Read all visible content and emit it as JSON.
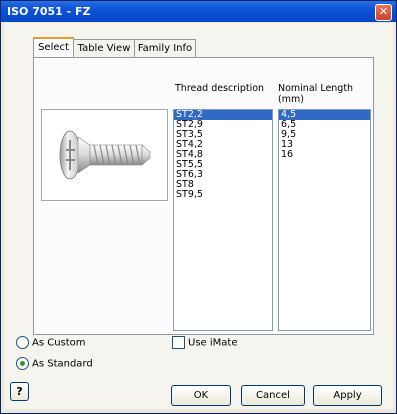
{
  "window": {
    "title": "ISO 7051 - FZ",
    "close_icon": "close-icon"
  },
  "tabs": [
    {
      "label": "Select",
      "active": true
    },
    {
      "label": "Table View",
      "active": false
    },
    {
      "label": "Family Info",
      "active": false
    }
  ],
  "thread": {
    "header": "Thread description",
    "items": [
      "ST2,2",
      "ST2,9",
      "ST3,5",
      "ST4,2",
      "ST4,8",
      "ST5,5",
      "ST6,3",
      "ST8",
      "ST9,5"
    ],
    "selected": "ST2,2"
  },
  "length": {
    "header_line1": "Nominal Length",
    "header_line2": "(mm)",
    "items": [
      "4,5",
      "6,5",
      "9,5",
      "13",
      "16"
    ],
    "selected": "4,5"
  },
  "options": {
    "as_custom": "As Custom",
    "as_standard": "As Standard",
    "use_imate": "Use iMate",
    "selected_mode": "As Standard",
    "use_imate_checked": false
  },
  "buttons": {
    "ok": "OK",
    "cancel": "Cancel",
    "apply": "Apply",
    "help": "?"
  },
  "colors": {
    "selection": "#316ac5",
    "titlebar": "#0a52d6",
    "tab_highlight": "#e69c2f"
  }
}
